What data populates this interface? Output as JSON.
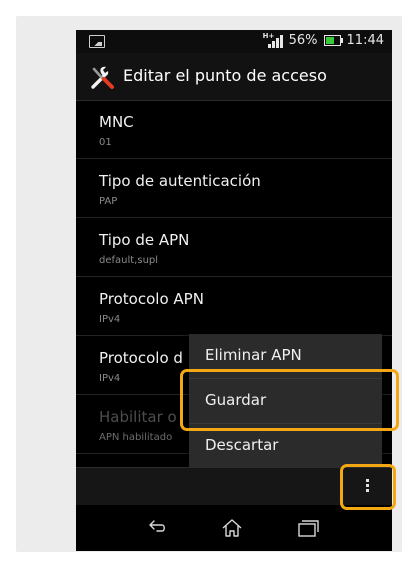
{
  "status_bar": {
    "signal_tag": "H+",
    "battery": "56%",
    "time": "11:44"
  },
  "action_bar": {
    "icon": "tools-icon",
    "title": "Editar el punto de acceso"
  },
  "settings": [
    {
      "title": "MNC",
      "value": "01",
      "enabled": true
    },
    {
      "title": "Tipo de autenticación",
      "value": "PAP",
      "enabled": true
    },
    {
      "title": "Tipo de APN",
      "value": "default,supl",
      "enabled": true
    },
    {
      "title": "Protocolo APN",
      "value": "IPv4",
      "enabled": true
    },
    {
      "title": "Protocolo d",
      "value": "IPv4",
      "enabled": true
    },
    {
      "title": "Habilitar o",
      "value": "APN habilitado",
      "enabled": false
    }
  ],
  "popup_menu": {
    "items": [
      {
        "label": "Eliminar APN"
      },
      {
        "label": "Guardar"
      },
      {
        "label": "Descartar"
      }
    ]
  },
  "overflow_button": {
    "icon": "overflow-menu-icon"
  },
  "nav_bar": {
    "icons": [
      "back-icon",
      "home-icon",
      "recent-apps-icon"
    ]
  },
  "colors": {
    "highlight": "#f3a712",
    "battery": "#39c83a",
    "background": "#000000"
  }
}
